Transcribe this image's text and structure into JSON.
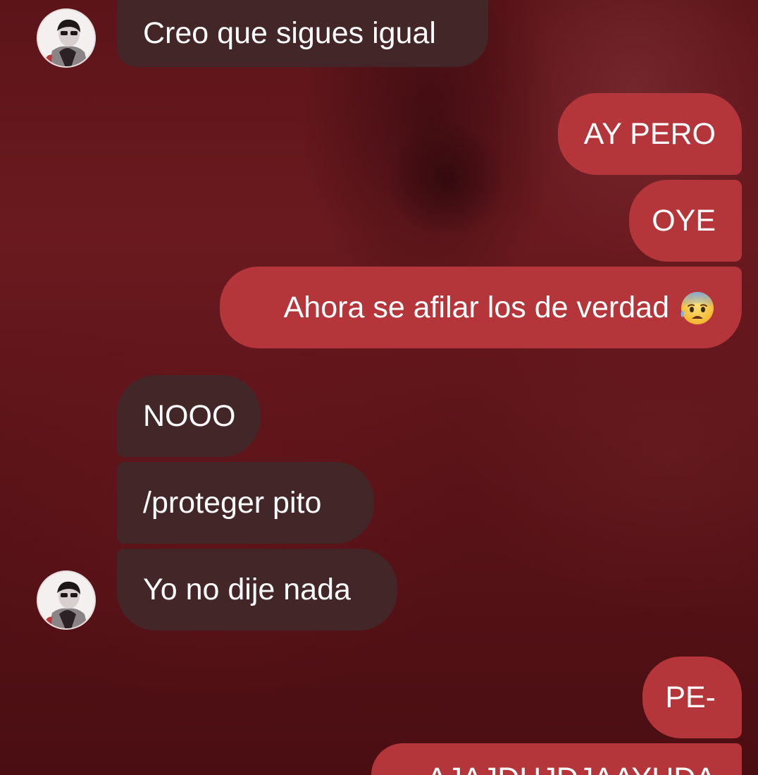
{
  "conversation": {
    "messages": [
      {
        "id": "m1",
        "side": "incoming",
        "text": "Creo que sigues igual"
      },
      {
        "id": "m2",
        "side": "outgoing",
        "text": "AY PERO"
      },
      {
        "id": "m3",
        "side": "outgoing",
        "text": "OYE"
      },
      {
        "id": "m4",
        "side": "outgoing",
        "text": "Ahora se afilar los de verdad",
        "emoji": "anxious-face-with-sweat-icon"
      },
      {
        "id": "m5",
        "side": "incoming",
        "text": "NOOO"
      },
      {
        "id": "m6",
        "side": "incoming",
        "text": "/proteger pito"
      },
      {
        "id": "m7",
        "side": "incoming",
        "text": "Yo no dije nada"
      },
      {
        "id": "m8",
        "side": "outgoing",
        "text": "PE-"
      },
      {
        "id": "m9",
        "side": "outgoing",
        "text": "AJAJDHJDJAAYUDA"
      }
    ]
  },
  "colors": {
    "incoming_bubble": "#432728",
    "outgoing_bubble": "#b4363a",
    "background": "#5c1419",
    "text": "#ffffff"
  }
}
